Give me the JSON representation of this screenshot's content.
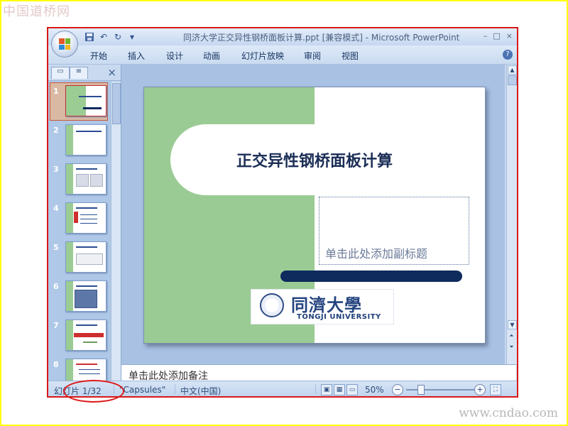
{
  "watermarks": {
    "top_left": "中国道桥网",
    "bottom_right": "www.cndao.com"
  },
  "window": {
    "title": "同济大学正交异性钢桥面板计算.ppt [兼容模式] - Microsoft PowerPoint",
    "buttons": [
      "–",
      "□",
      "×"
    ]
  },
  "ribbon": {
    "tabs": [
      "开始",
      "插入",
      "设计",
      "动画",
      "幻灯片放映",
      "审阅",
      "视图"
    ]
  },
  "left_pane": {
    "tab1": "▭",
    "tab2": "≡",
    "close": "×",
    "slides": [
      {
        "number": "1",
        "selected": true
      },
      {
        "number": "2",
        "selected": false
      },
      {
        "number": "3",
        "selected": false
      },
      {
        "number": "4",
        "selected": false
      },
      {
        "number": "5",
        "selected": false
      },
      {
        "number": "6",
        "selected": false
      },
      {
        "number": "7",
        "selected": false
      },
      {
        "number": "8",
        "selected": false
      }
    ]
  },
  "slide": {
    "title": "正交异性钢桥面板计算",
    "subtitle_placeholder": "单击此处添加副标题",
    "logo_cn": "同濟大學",
    "logo_en": "TONGJI UNIVERSITY"
  },
  "notes": {
    "placeholder": "单击此处添加备注"
  },
  "status": {
    "slide_counter": "幻灯片 1/32",
    "theme": "\"Capsules\"",
    "language": "中文(中国)",
    "zoom": "50%"
  },
  "colors": {
    "outline_red": "#d81818",
    "slide_green": "#9bcb94",
    "navy": "#0f2a5d"
  }
}
